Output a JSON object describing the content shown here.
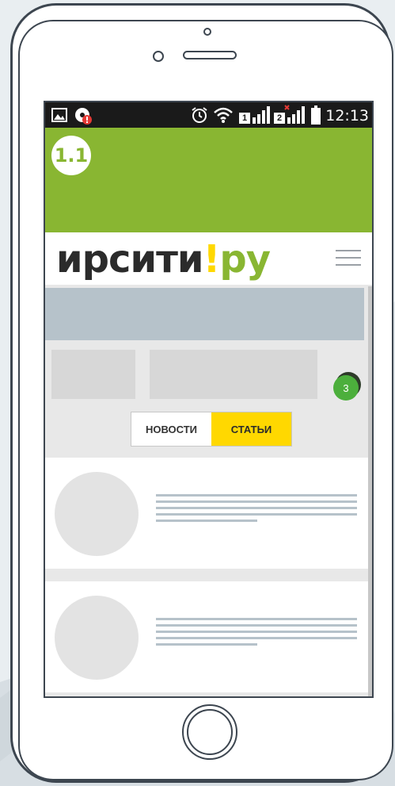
{
  "status_bar": {
    "time": "12:13",
    "sim1_label": "1",
    "sim2_label": "2"
  },
  "tutorial": {
    "step_label": "1.1"
  },
  "site": {
    "logo_main": "ирсити",
    "logo_excl": "!",
    "logo_suffix": "ру"
  },
  "count_badge": "3",
  "tabs": [
    {
      "label": "НОВОСТИ",
      "active": false
    },
    {
      "label": "СТАТЬИ",
      "active": true
    }
  ],
  "colors": {
    "header_green": "#89b632",
    "accent_yellow": "#ffd800",
    "badge_green": "#4caf3c",
    "placeholder_gray": "#d7d7d7",
    "placeholder_blue_gray": "#b6c2ca"
  }
}
